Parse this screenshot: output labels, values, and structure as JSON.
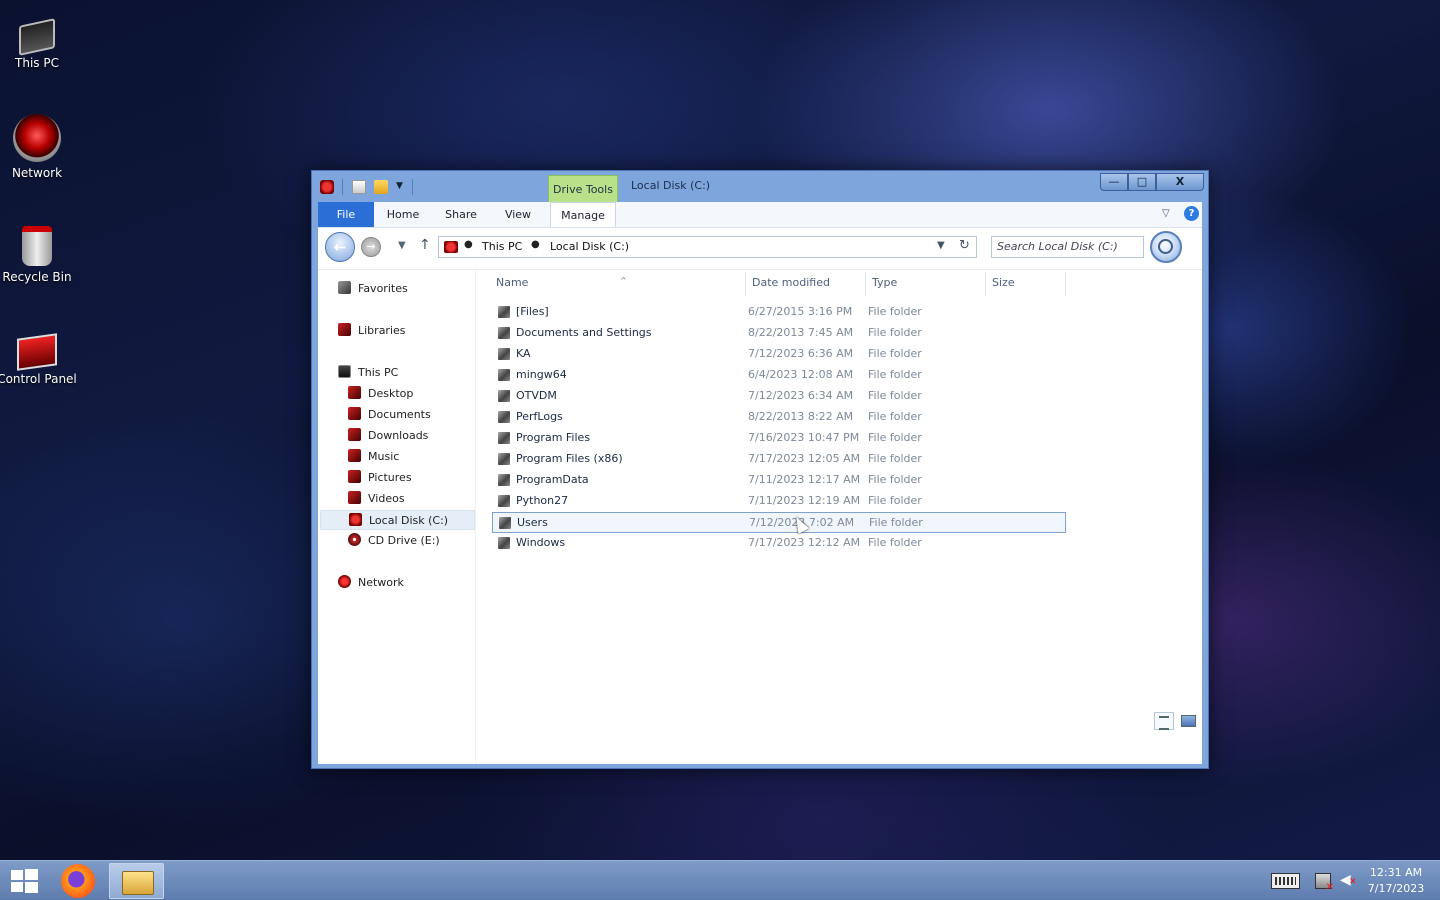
{
  "desktop": {
    "icons": [
      {
        "label": "This PC"
      },
      {
        "label": "Network"
      },
      {
        "label": "Recycle Bin"
      },
      {
        "label": "Control Panel"
      }
    ]
  },
  "window": {
    "title": "Local Disk (C:)",
    "context_tab": "Drive Tools",
    "buttons": {
      "minimize": "—",
      "maximize": "□",
      "close": "X"
    },
    "ribbon_tabs": {
      "file": "File",
      "home": "Home",
      "share": "Share",
      "view": "View",
      "manage": "Manage"
    },
    "help": "?",
    "address": {
      "segments": [
        "This PC",
        "Local Disk (C:)"
      ]
    },
    "search": {
      "placeholder": "Search Local Disk (C:)"
    },
    "nav_pane": {
      "favorites": "Favorites",
      "libraries": "Libraries",
      "this_pc": "This PC",
      "desktop": "Desktop",
      "documents": "Documents",
      "downloads": "Downloads",
      "music": "Music",
      "pictures": "Pictures",
      "videos": "Videos",
      "local_disk": "Local Disk (C:)",
      "cd_drive": "CD Drive (E:)",
      "network": "Network"
    },
    "columns": {
      "name": "Name",
      "date": "Date modified",
      "type": "Type",
      "size": "Size"
    },
    "files": [
      {
        "name": "[Files]",
        "date": "6/27/2015 3:16 PM",
        "type": "File folder"
      },
      {
        "name": "Documents and Settings",
        "date": "8/22/2013 7:45 AM",
        "type": "File folder"
      },
      {
        "name": "KA",
        "date": "7/12/2023 6:36 AM",
        "type": "File folder"
      },
      {
        "name": "mingw64",
        "date": "6/4/2023 12:08 AM",
        "type": "File folder"
      },
      {
        "name": "OTVDM",
        "date": "7/12/2023 6:34 AM",
        "type": "File folder"
      },
      {
        "name": "PerfLogs",
        "date": "8/22/2013 8:22 AM",
        "type": "File folder"
      },
      {
        "name": "Program Files",
        "date": "7/16/2023 10:47 PM",
        "type": "File folder"
      },
      {
        "name": "Program Files (x86)",
        "date": "7/17/2023 12:05 AM",
        "type": "File folder"
      },
      {
        "name": "ProgramData",
        "date": "7/11/2023 12:17 AM",
        "type": "File folder"
      },
      {
        "name": "Python27",
        "date": "7/11/2023 12:19 AM",
        "type": "File folder"
      },
      {
        "name": "Users",
        "date": "7/12/2023 7:02 AM",
        "type": "File folder"
      },
      {
        "name": "Windows",
        "date": "7/17/2023 12:12 AM",
        "type": "File folder"
      }
    ]
  },
  "taskbar": {
    "clock": {
      "time": "12:31 AM",
      "date": "7/17/2023"
    }
  }
}
